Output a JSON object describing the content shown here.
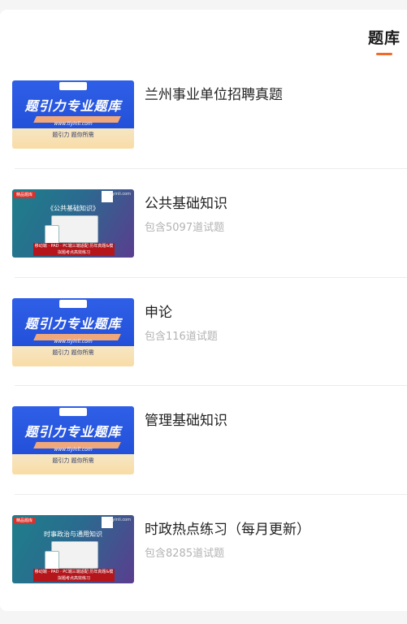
{
  "header": {
    "tab_label": "题库"
  },
  "items": [
    {
      "title": "兰州事业单位招聘真题",
      "subtitle": "",
      "thumb": "blue",
      "thumb_text": {
        "brand": "题引力专业题库",
        "url": "www.tiyinli.com",
        "tag": "题引力 题你所需"
      }
    },
    {
      "title": "公共基础知识",
      "subtitle": "包含5097道试题",
      "thumb": "teal",
      "thumb_text": {
        "badge": "精品题库",
        "site": "tiyinli.com",
        "name": "《公共基础知识》",
        "bar": "移动端 · PAD · PC端三端适配 历年真题&模拟题考点高效练习"
      }
    },
    {
      "title": "申论",
      "subtitle": "包含116道试题",
      "thumb": "blue",
      "thumb_text": {
        "brand": "题引力专业题库",
        "url": "www.tiyinli.com",
        "tag": "题引力 题你所需"
      }
    },
    {
      "title": "管理基础知识",
      "subtitle": "",
      "thumb": "blue",
      "thumb_text": {
        "brand": "题引力专业题库",
        "url": "www.tiyinli.com",
        "tag": "题引力 题你所需"
      }
    },
    {
      "title": "时政热点练习（每月更新）",
      "subtitle": "包含8285道试题",
      "thumb": "teal",
      "thumb_text": {
        "badge": "精品题库",
        "site": "tiyinli.com",
        "name": "时事政治与通用知识",
        "bar": "移动端 · PAD · PC端三端适配 历年真题&模拟题考点高效练习"
      }
    }
  ],
  "colors": {
    "accent": "#f26a2a",
    "title": "#222222",
    "subtitle": "#b3b3b3"
  }
}
